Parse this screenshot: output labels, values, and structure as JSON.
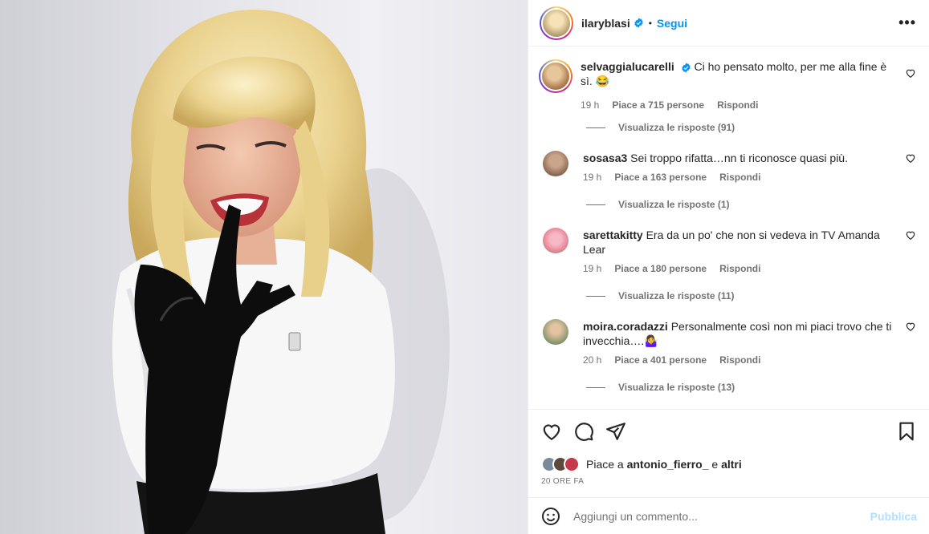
{
  "post": {
    "author": "ilaryblasi",
    "follow_label": "Segui",
    "dot": "•",
    "more_icon": "more-horizontal-icon"
  },
  "comments": [
    {
      "user": "selvaggialucarelli",
      "verified": true,
      "text": "Ci ho pensato molto, per me alla fine è sì. 😂",
      "time": "19 h",
      "likes": "Piace a 715 persone",
      "reply": "Rispondi",
      "view_replies": "Visualizza le risposte (91)",
      "avatar_color": "#b8875b"
    },
    {
      "user": "sosasa3",
      "verified": false,
      "text": "Sei troppo rifatta…nn ti riconosce quasi più.",
      "time": "19 h",
      "likes": "Piace a 163 persone",
      "reply": "Rispondi",
      "view_replies": "Visualizza le risposte (1)",
      "avatar_color": "#8a6a52"
    },
    {
      "user": "sarettakitty",
      "verified": false,
      "text": "Era da un po' che non si vedeva in TV Amanda Lear",
      "time": "19 h",
      "likes": "Piace a 180 persone",
      "reply": "Rispondi",
      "view_replies": "Visualizza le risposte (11)",
      "avatar_color": "#e88a9a"
    },
    {
      "user": "moira.coradazzi",
      "verified": false,
      "text": "Personalmente così non mi piaci trovo che ti invecchia….🤷‍♀️",
      "time": "20 h",
      "likes": "Piace a 401 persone",
      "reply": "Rispondi",
      "view_replies": "Visualizza le risposte (13)",
      "avatar_color": "#9aa07a"
    }
  ],
  "liked_by": {
    "prefix": "Piace a",
    "user": "antonio_fierro_",
    "conj": "e",
    "others": "altri"
  },
  "timestamp": "20 ORE FA",
  "add_comment": {
    "placeholder": "Aggiungi un commento...",
    "publish": "Pubblica"
  },
  "colors": {
    "accent": "#0095f6",
    "publish_disabled": "#b2dffc",
    "muted": "#737373"
  }
}
